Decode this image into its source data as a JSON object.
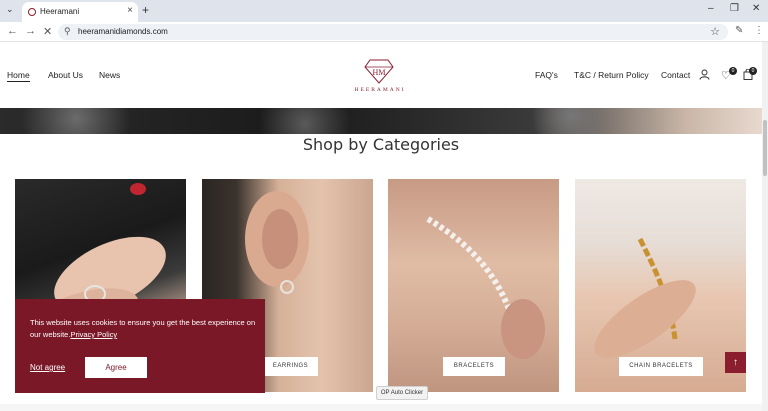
{
  "browser": {
    "tab_title": "Heeramani",
    "url": "heeramanidiamonds.com",
    "new_tab": "+",
    "tab_close": "×",
    "tab_list": "⌄",
    "minimize": "–",
    "maximize": "❐",
    "close": "✕",
    "back": "←",
    "forward": "→",
    "stop": "✕",
    "star": "☆",
    "menu": "⋮"
  },
  "header": {
    "nav_left": [
      "Home",
      "About Us",
      "News"
    ],
    "logo_text": "HEERAMANI",
    "nav_right": [
      "FAQ's",
      "T&C / Return Policy",
      "Contact"
    ],
    "wishlist_count": "0",
    "cart_count": "0"
  },
  "section": {
    "title": "Shop by Categories"
  },
  "categories": [
    {
      "label": ""
    },
    {
      "label": "EARRINGS"
    },
    {
      "label": "BRACELETS"
    },
    {
      "label": "CHAIN BRACELETS"
    }
  ],
  "cookie": {
    "message": "This website uses cookies to ensure you get the best experience on our website.",
    "link": "Privacy Policy",
    "not_agree": "Not agree",
    "agree": "Agree"
  },
  "back_to_top": "↑",
  "op_clicker": "OP Auto Clicker",
  "colors": {
    "brand": "#7a1828"
  }
}
